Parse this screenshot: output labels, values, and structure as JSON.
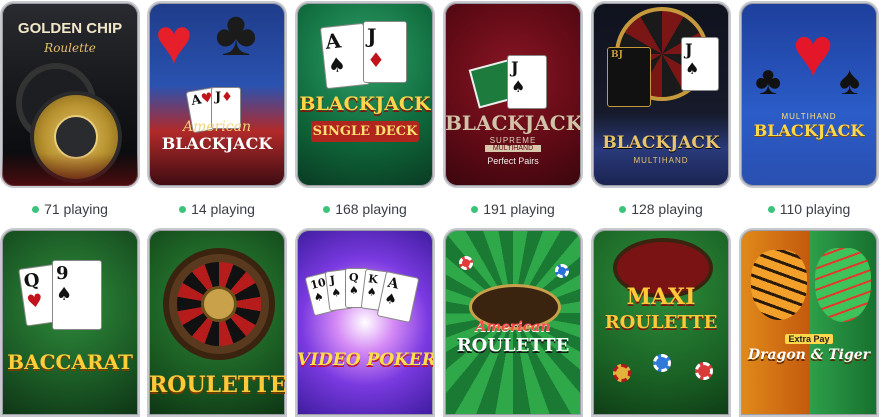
{
  "games_row1": [
    {
      "title_line1": "GOLDEN CHIP",
      "title_line2": "Roulette",
      "players": "71 playing"
    },
    {
      "title_line1": "American",
      "title_line2": "BLACKJACK",
      "players": "14 playing"
    },
    {
      "title_line1": "BLACKJACK",
      "title_line2": "SINGLE DECK",
      "players": "168 playing"
    },
    {
      "title_line1": "BLACKJACK",
      "title_line2": "SUPREME",
      "title_line3": "MULTIHAND",
      "title_line4": "Perfect Pairs",
      "players": "191 playing"
    },
    {
      "title_line1": "BLACKJACK",
      "title_line2": "MULTIHAND",
      "players": "128 playing"
    },
    {
      "title_line1": "MULTIHAND",
      "title_line2": "BLACKJACK",
      "players": "110 playing"
    }
  ],
  "games_row2": [
    {
      "title": "BACCARAT"
    },
    {
      "title": "ROULETTE"
    },
    {
      "title": "VIDEO POKER"
    },
    {
      "title_line1": "American",
      "title_line2": "ROULETTE"
    },
    {
      "title_line1": "MAXI",
      "title_line2": "ROULETTE"
    },
    {
      "title_line1": "Extra Pay",
      "title_line2": "Dragon & Tiger"
    }
  ],
  "status_color": "#3cc27a"
}
